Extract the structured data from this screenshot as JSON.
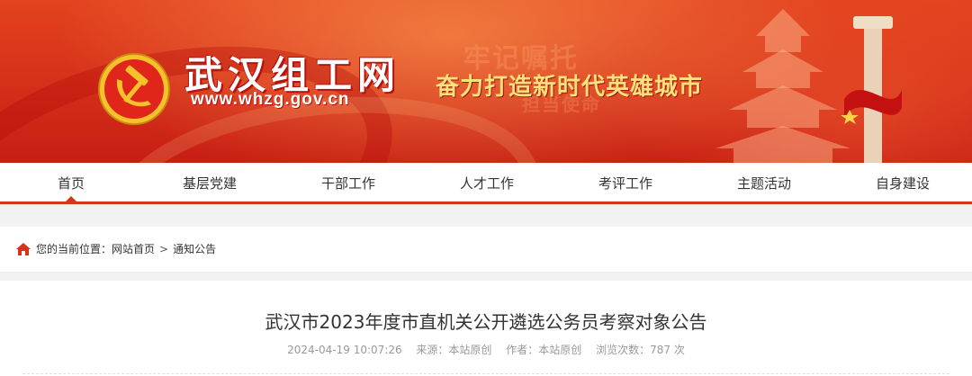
{
  "banner": {
    "site_title": "武汉组工网",
    "site_url": "www.whzg.gov.cn",
    "slogan": "奋力打造新时代英雄城市",
    "ghost_line1": "牢记嘱托",
    "ghost_line2": "担当使命"
  },
  "nav": {
    "items": [
      {
        "label": "首页"
      },
      {
        "label": "基层党建"
      },
      {
        "label": "干部工作"
      },
      {
        "label": "人才工作"
      },
      {
        "label": "考评工作"
      },
      {
        "label": "主题活动"
      },
      {
        "label": "自身建设"
      }
    ],
    "active_index": 0
  },
  "breadcrumb": {
    "prefix": "您的当前位置：",
    "home": "网站首页",
    "separator": ">",
    "current": "通知公告"
  },
  "article": {
    "title": "武汉市2023年度市直机关公开遴选公务员考察对象公告",
    "date": "2024-04-19 10:07:26",
    "source": "来源：本站原创",
    "author": "作者：本站原创",
    "views": "浏览次数：787 次"
  },
  "colors": {
    "brand_red": "#d7321a",
    "slogan_gold": "#ffe27a"
  },
  "icons": {
    "home": "home-icon",
    "emblem": "party-emblem-icon"
  }
}
